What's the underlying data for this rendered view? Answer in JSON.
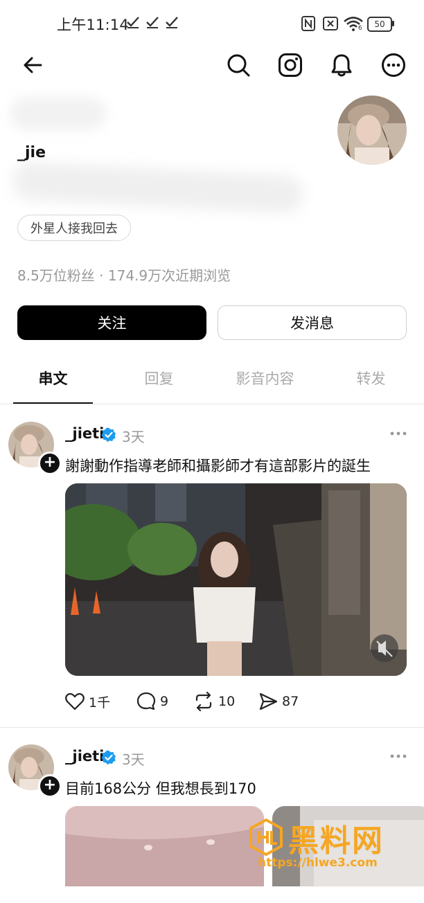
{
  "status_bar": {
    "time": "上午11:14",
    "battery": "50",
    "network_small": "6"
  },
  "nav": {
    "icons": [
      "back-arrow-icon",
      "search-icon",
      "instagram-icon",
      "bell-icon",
      "more-icon"
    ]
  },
  "profile": {
    "name": "_jie",
    "bio_chip": "外星人接我回去",
    "stats": "8.5万位粉丝 · 174.9万次近期浏览",
    "follow_label": "关注",
    "message_label": "发消息"
  },
  "tabs": [
    {
      "label": "串文",
      "active": true
    },
    {
      "label": "回复",
      "active": false
    },
    {
      "label": "影音内容",
      "active": false
    },
    {
      "label": "转发",
      "active": false
    }
  ],
  "posts": [
    {
      "username": "_jieti",
      "time": "3天",
      "text": "謝謝動作指導老師和攝影師才有這部影片的誕生",
      "likes": "1千",
      "comments": "9",
      "reposts": "10",
      "shares": "87"
    },
    {
      "username": "_jieti",
      "time": "3天",
      "text": "目前168公分 但我想長到170"
    }
  ],
  "watermark": {
    "name": "黑料网",
    "url": "https://hlwe3.com"
  },
  "colors": {
    "accent_verified": "#1d9bf0",
    "primary_button": "#000000",
    "watermark": "#f5a623"
  }
}
